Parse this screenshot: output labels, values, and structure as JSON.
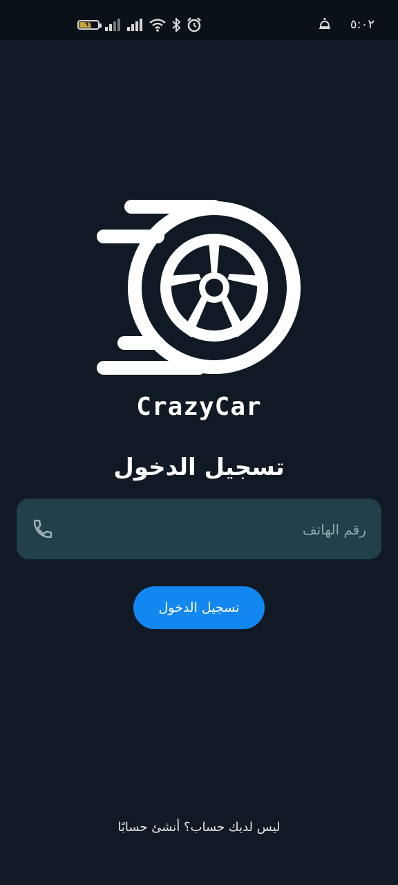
{
  "status_bar": {
    "time": "٥:٠٢",
    "battery_level": "٦٦",
    "icons": [
      "battery-icon",
      "signal-icon",
      "signal-icon",
      "wifi-icon",
      "bluetooth-icon",
      "alarm-icon",
      "notification-icon"
    ]
  },
  "brand": {
    "logo_icon": "wheel-speed-icon",
    "name": "CrazyCar"
  },
  "login": {
    "title": "تسجيل الدخول",
    "phone_placeholder": "رقم الهاتف",
    "phone_value": "",
    "phone_icon": "phone-icon",
    "submit_label": "تسجيل الدخول",
    "signup_prompt": "ليس لديك حساب؟ أنشئ حسابًا"
  },
  "colors": {
    "background": "#111a24",
    "status_bar": "#0b1118",
    "input_background": "#223f4c",
    "primary_button": "#1287f0",
    "text": "#ffffff",
    "placeholder": "#8fa6b1"
  }
}
